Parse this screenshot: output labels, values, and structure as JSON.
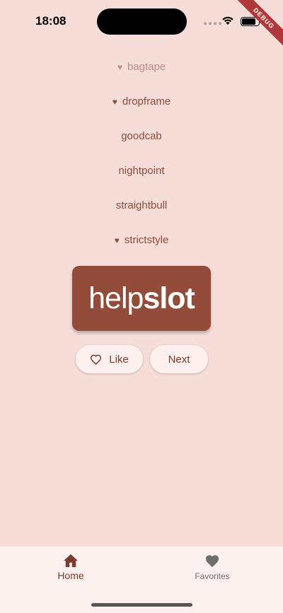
{
  "status_bar": {
    "time": "18:08"
  },
  "debug_banner": "DEBUG",
  "history": [
    {
      "word": "bagtape",
      "favorite": true,
      "faded": true
    },
    {
      "word": "dropframe",
      "favorite": true,
      "faded": false
    },
    {
      "word": "goodcab",
      "favorite": false,
      "faded": false
    },
    {
      "word": "nightpoint",
      "favorite": false,
      "faded": false
    },
    {
      "word": "straightbull",
      "favorite": false,
      "faded": false
    },
    {
      "word": "strictstyle",
      "favorite": true,
      "faded": false
    }
  ],
  "current_pair": {
    "first": "help",
    "second": "slot"
  },
  "actions": {
    "like_label": "Like",
    "next_label": "Next"
  },
  "nav": {
    "home_label": "Home",
    "favorites_label": "Favorites"
  },
  "colors": {
    "background": "#F6DDD8",
    "primary": "#934B3A",
    "text": "#8E4B3C"
  }
}
